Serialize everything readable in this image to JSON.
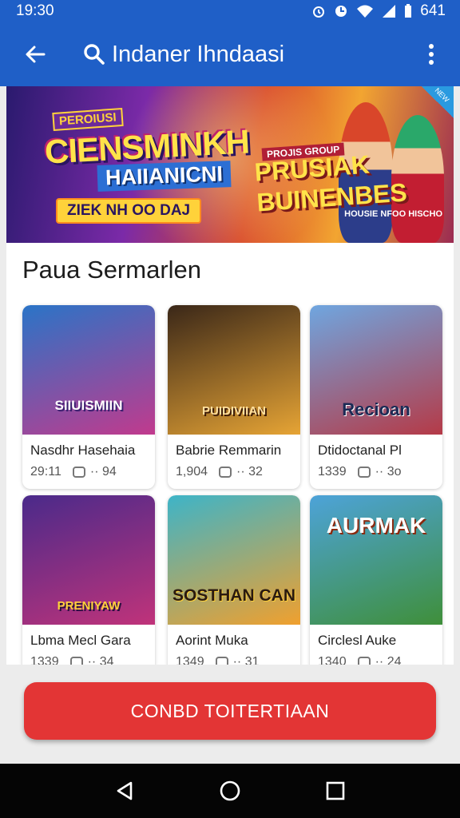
{
  "status_bar": {
    "time": "19:30",
    "battery": "641"
  },
  "app_bar": {
    "search_text": "Indaner Ihndaasi",
    "back_icon": "back-arrow-icon",
    "search_icon": "search-icon",
    "more_icon": "more-vert-icon"
  },
  "banner": {
    "small_label": "PEROIUSI",
    "title": "CIENSMINKH",
    "subtitle": "HAIIANICNI",
    "date_label": "ZIEK NH OO DAJ",
    "tag": "PROJIS GROUP",
    "promo_line1": "PRUSIAK",
    "promo_line2": "BUINENBES",
    "corner_text": "NEW",
    "note": "HOUSIE NFOO HISCHO"
  },
  "section": {
    "title": "Paua Sermarlen"
  },
  "games": [
    {
      "thumb_text": "SIIUISMIIN",
      "title": "Nasdhr Hasehaia",
      "count": "29:11",
      "meta": "·· 94",
      "colors": [
        "#2a74c7",
        "#c13a8d"
      ]
    },
    {
      "thumb_text": "PUIDIVIIAN",
      "title": "Babrie Remmarin",
      "count": "1,904",
      "meta": "·· 32",
      "colors": [
        "#3a2718",
        "#e6a435"
      ]
    },
    {
      "thumb_text": "Recioan",
      "title": "Dtidoctanal Pl",
      "count": "1339",
      "meta": "·· 3o",
      "colors": [
        "#6fa6e0",
        "#b53a47"
      ]
    },
    {
      "thumb_text": "PRENIYAW",
      "title": "Lbma Mecl Gara",
      "count": "1339",
      "meta": "·· 34",
      "colors": [
        "#4a2a8a",
        "#c0337a"
      ]
    },
    {
      "thumb_text": "SOSTHAN CANGLK",
      "title": "Aorint Muka",
      "count": "1349",
      "meta": "·· 31",
      "colors": [
        "#3db4c8",
        "#f0a02e"
      ]
    },
    {
      "thumb_text": "AURMAK",
      "title": "Circlesl Auke",
      "count": "1340",
      "meta": "·· 24",
      "colors": [
        "#4da3d9",
        "#3f8f3a"
      ]
    }
  ],
  "cta": {
    "label": "CONBD TOITERTIAAN"
  },
  "nav": {
    "back": "back-triangle-icon",
    "home": "home-circle-icon",
    "recents": "recents-square-icon"
  }
}
